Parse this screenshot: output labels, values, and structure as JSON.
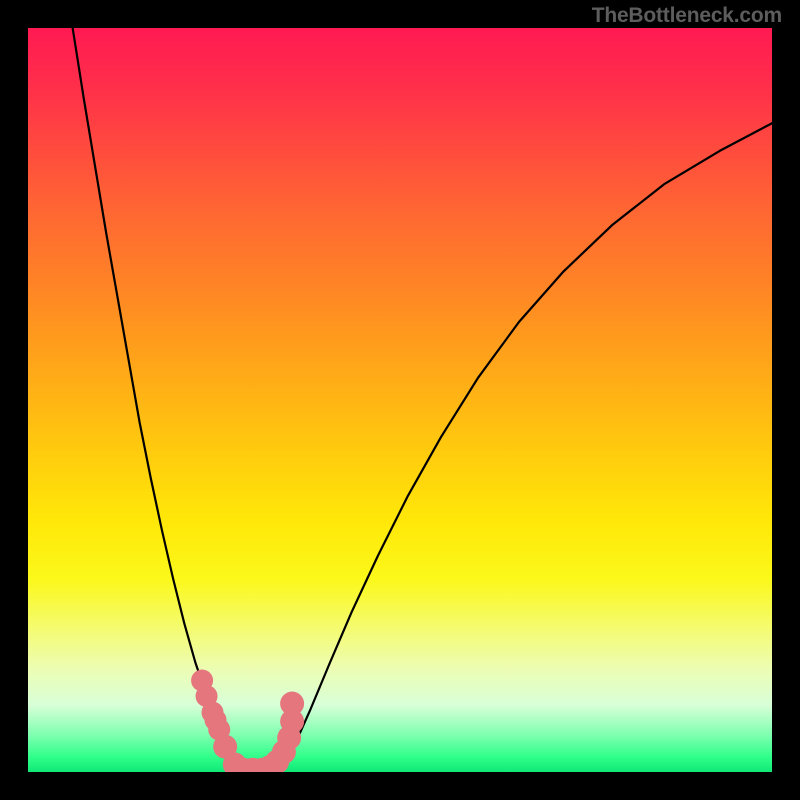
{
  "watermark": "TheBottleneck.com",
  "chart_data": {
    "type": "line",
    "title": "",
    "xlabel": "",
    "ylabel": "",
    "xlim": [
      0,
      1
    ],
    "ylim": [
      0,
      1
    ],
    "grid": false,
    "legend": false,
    "series": [
      {
        "name": "left-branch",
        "color": "#000000",
        "x": [
          0.06,
          0.075,
          0.09,
          0.105,
          0.12,
          0.135,
          0.15,
          0.165,
          0.18,
          0.195,
          0.21,
          0.225,
          0.24,
          0.252,
          0.262,
          0.273,
          0.283,
          0.29
        ],
        "y": [
          1.0,
          0.905,
          0.815,
          0.725,
          0.64,
          0.555,
          0.47,
          0.395,
          0.325,
          0.26,
          0.2,
          0.147,
          0.103,
          0.07,
          0.047,
          0.028,
          0.013,
          0.004
        ]
      },
      {
        "name": "right-branch",
        "color": "#000000",
        "x": [
          0.34,
          0.36,
          0.38,
          0.405,
          0.435,
          0.47,
          0.51,
          0.555,
          0.605,
          0.66,
          0.72,
          0.785,
          0.855,
          0.93,
          1.0
        ],
        "y": [
          0.012,
          0.04,
          0.085,
          0.145,
          0.215,
          0.29,
          0.37,
          0.45,
          0.53,
          0.605,
          0.673,
          0.735,
          0.79,
          0.835,
          0.872
        ]
      },
      {
        "name": "valley-floor",
        "color": "#000000",
        "x": [
          0.29,
          0.3,
          0.312,
          0.325,
          0.34
        ],
        "y": [
          0.004,
          0.0,
          0.0,
          0.003,
          0.012
        ]
      }
    ],
    "markers": [
      {
        "name": "pink-dots-left",
        "color": "#e5767e",
        "x": [
          0.234,
          0.24,
          0.248,
          0.252,
          0.257,
          0.265,
          0.278,
          0.289,
          0.302,
          0.315,
          0.326,
          0.335,
          0.344,
          0.351,
          0.355,
          0.355
        ],
        "y": [
          0.123,
          0.102,
          0.08,
          0.07,
          0.057,
          0.034,
          0.01,
          0.003,
          0.003,
          0.003,
          0.007,
          0.014,
          0.027,
          0.046,
          0.068,
          0.092
        ],
        "size": [
          11,
          11,
          11,
          11,
          11,
          12,
          12,
          12,
          12,
          12,
          12,
          12,
          12,
          12,
          12,
          12
        ]
      }
    ],
    "gradient_stops": [
      {
        "pos": 0.0,
        "color": "#ff1a52"
      },
      {
        "pos": 0.5,
        "color": "#ffc50f"
      },
      {
        "pos": 0.8,
        "color": "#f5fb67"
      },
      {
        "pos": 1.0,
        "color": "#10e876"
      }
    ]
  }
}
